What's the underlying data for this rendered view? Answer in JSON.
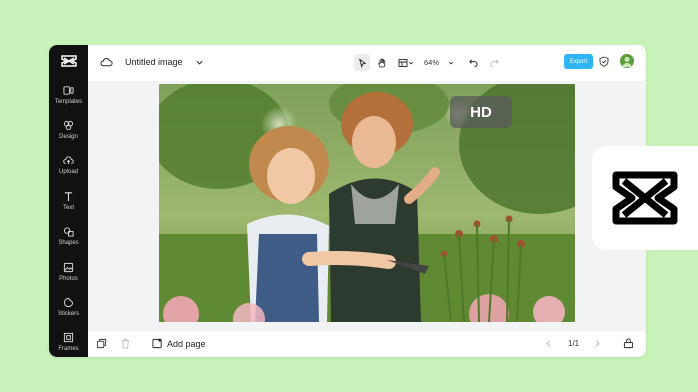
{
  "app": {
    "logo_icon": "capcut-logo-icon",
    "brand_color": "#000000"
  },
  "sidebar": {
    "items": [
      {
        "label": "Templates",
        "icon": "templates-icon"
      },
      {
        "label": "Design",
        "icon": "design-icon"
      },
      {
        "label": "Upload",
        "icon": "upload-icon"
      },
      {
        "label": "Text",
        "icon": "text-icon"
      },
      {
        "label": "Shapes",
        "icon": "shapes-icon"
      },
      {
        "label": "Photos",
        "icon": "photos-icon"
      },
      {
        "label": "Stickers",
        "icon": "stickers-icon"
      },
      {
        "label": "Frames",
        "icon": "frames-icon"
      }
    ]
  },
  "topbar": {
    "title": "Untitled image",
    "zoom": "64%",
    "export_label": "Export",
    "accent": "#2fb5f5"
  },
  "canvas": {
    "badge": "HD"
  },
  "bottombar": {
    "add_page_label": "Add page",
    "page_indicator": "1/1"
  }
}
